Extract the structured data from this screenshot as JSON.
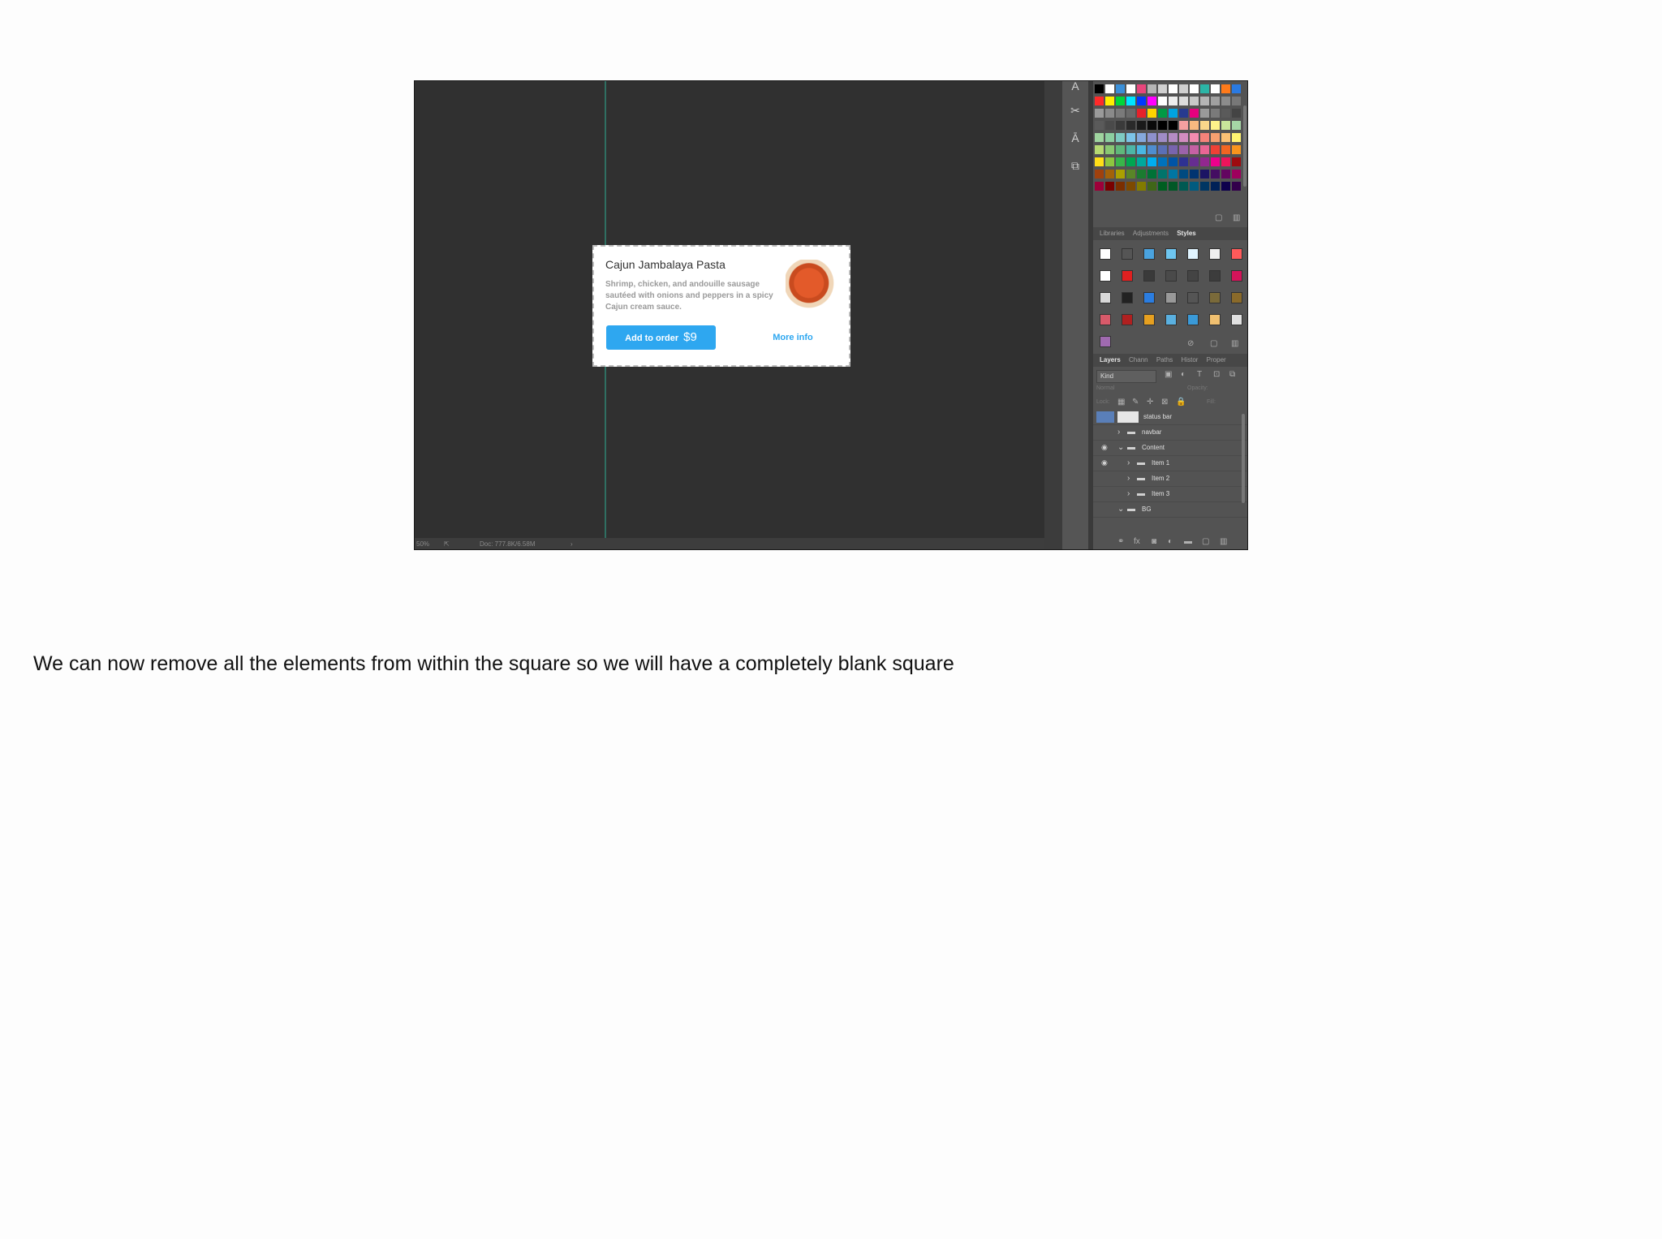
{
  "caption": "We can now remove all the elements from within the square so we will have a completely blank square",
  "card": {
    "title": "Cajun Jambalaya Pasta",
    "description": "Shrimp, chicken, and andouille sausage sautéed with onions and peppers in a spicy Cajun cream sauce.",
    "add_label": "Add to order",
    "price": "$9",
    "more_label": "More info"
  },
  "status_bar": {
    "zoom": "50%",
    "doc": "Doc: 777.8K/6.58M"
  },
  "tools": {
    "icons": [
      "character-icon",
      "scissors-icon",
      "paragraph-style-icon",
      "glyph-icon"
    ]
  },
  "panels": {
    "styles_tabs": [
      "Libraries",
      "Adjustments",
      "Styles"
    ],
    "layers_tabs": [
      "Layers",
      "Chann",
      "Paths",
      "Histor",
      "Proper"
    ],
    "filter_kind": "Kind",
    "blend_mode": "Normal",
    "opacity_label": "Opacity:",
    "lock_label": "Lock:",
    "fill_label": "Fill:",
    "layers": [
      {
        "name": "status bar",
        "indent": 0,
        "type": "layer"
      },
      {
        "name": "navbar",
        "indent": 0,
        "type": "group"
      },
      {
        "name": "Content",
        "indent": 0,
        "type": "group-open"
      },
      {
        "name": "Item 1",
        "indent": 1,
        "type": "group"
      },
      {
        "name": "Item 2",
        "indent": 1,
        "type": "group"
      },
      {
        "name": "Item 3",
        "indent": 1,
        "type": "group"
      },
      {
        "name": "BG",
        "indent": 0,
        "type": "group-open"
      }
    ]
  },
  "swatch_colors": [
    "#000000",
    "#ffffff",
    "#3a8fd8",
    "#ffffff",
    "#e8467c",
    "#b5b5b5",
    "#d0d0d0",
    "#ffffff",
    "#cfcfcf",
    "#ffffff",
    "#2bb5a6",
    "#ffffff",
    "#ff7a1a",
    "#2a7ae2",
    "#ff2a2a",
    "#ffee00",
    "#00d639",
    "#00e5ff",
    "#0039ff",
    "#ff00ff",
    "#ffffff",
    "#eeeeee",
    "#dcdcdc",
    "#c8c8c8",
    "#b4b4b4",
    "#a0a0a0",
    "#8c8c8c",
    "#787878",
    "#9a9a9a",
    "#8a8a8a",
    "#7a7a7a",
    "#6a6a6a",
    "#e6212a",
    "#ffd400",
    "#009a44",
    "#00a3e0",
    "#263a8f",
    "#e6007e",
    "#9a9a9a",
    "#7a7a7a",
    "#5a5a5a",
    "#444444",
    "#5a5a5a",
    "#4a4a4a",
    "#3a3a3a",
    "#2a2a2a",
    "#1a1a1a",
    "#0a0a0a",
    "#000000",
    "#000000",
    "#f5a0a0",
    "#f7b980",
    "#fad68a",
    "#fff38a",
    "#c9e59a",
    "#a6d6a6",
    "#9fd49f",
    "#8ccfa0",
    "#7ecbc2",
    "#7cc4e7",
    "#85a9dc",
    "#8e91cc",
    "#a08cc6",
    "#b58cc4",
    "#d28cc0",
    "#f28cb0",
    "#f5837a",
    "#f6a070",
    "#fbc174",
    "#fff371",
    "#b6d972",
    "#89c872",
    "#5fb87a",
    "#4db6a6",
    "#49b6e2",
    "#4f8dcf",
    "#5a6fb6",
    "#7864ad",
    "#9b62aa",
    "#c561a4",
    "#e96594",
    "#ef4136",
    "#f26522",
    "#f7941d",
    "#ffde17",
    "#8dc63f",
    "#39b54a",
    "#00a651",
    "#00a99d",
    "#00aeef",
    "#0072bc",
    "#0054a6",
    "#2e3192",
    "#662d91",
    "#92278f",
    "#ec008c",
    "#ed145b",
    "#9e0b0f",
    "#a0410d",
    "#a36209",
    "#aba000",
    "#598527",
    "#1a7b30",
    "#007236",
    "#00746b",
    "#0076a3",
    "#004a80",
    "#003471",
    "#1b1464",
    "#440e62",
    "#630460",
    "#9e005d",
    "#9e0039",
    "#790000",
    "#7b2e00",
    "#7d4900",
    "#827b00",
    "#406618",
    "#005e20",
    "#005826",
    "#005952",
    "#005b7f",
    "#003663",
    "#002157",
    "#0d004c",
    "#32004b"
  ],
  "style_swatch_colors": [
    "#ffffff",
    "#555555",
    "#4aa3df",
    "#6ec6f0",
    "#e0f4ff",
    "#f0f0f0",
    "#ff5a5a",
    "#ffffff",
    "#e02020",
    "#3a3a3a",
    "#4a4a4a",
    "#444444",
    "#3c3c3c",
    "#d4145a",
    "#d8d8d8",
    "#222222",
    "#2b7de0",
    "#999999",
    "#555555",
    "#7a6a3a",
    "#8a6a2a",
    "#d85a6a",
    "#b02020",
    "#e6a020",
    "#5ab0e0",
    "#3a9ad8",
    "#f0c070",
    "#e0e0e0",
    "#a06ab0"
  ]
}
